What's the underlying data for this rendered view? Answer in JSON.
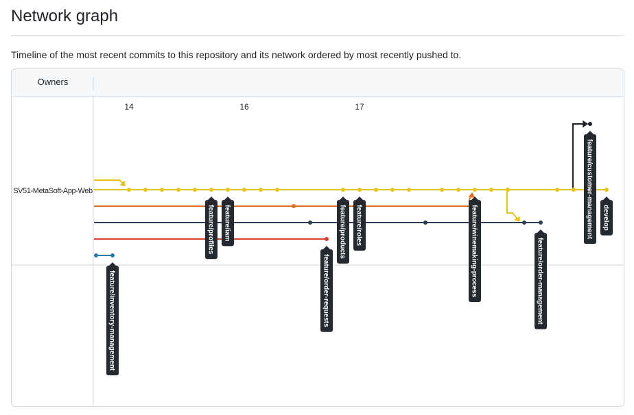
{
  "page": {
    "title": "Network graph",
    "description": "Timeline of the most recent commits to this repository and its network ordered by most recently pushed to."
  },
  "graph": {
    "owners_header": "Owners",
    "owner": "SV51-MetaSoft-App-Web",
    "dates": [
      "14",
      "16",
      "17"
    ],
    "colors": {
      "yellow": "#e8c21c",
      "orange": "#e36f22",
      "navy": "#2b3e50",
      "red": "#d9412e",
      "blue": "#2d78a6",
      "black": "#1f2328",
      "tag_bg": "#24292f"
    },
    "branches": [
      {
        "label": "feature/inventory-management"
      },
      {
        "label": "feature/profiles"
      },
      {
        "label": "feature/iam"
      },
      {
        "label": "feature/order-requests"
      },
      {
        "label": "feature/products"
      },
      {
        "label": "feature/roles"
      },
      {
        "label": "feature/winemaking-process"
      },
      {
        "label": "feature/order-management"
      },
      {
        "label": "feature/customer-management"
      },
      {
        "label": "develop"
      }
    ]
  }
}
